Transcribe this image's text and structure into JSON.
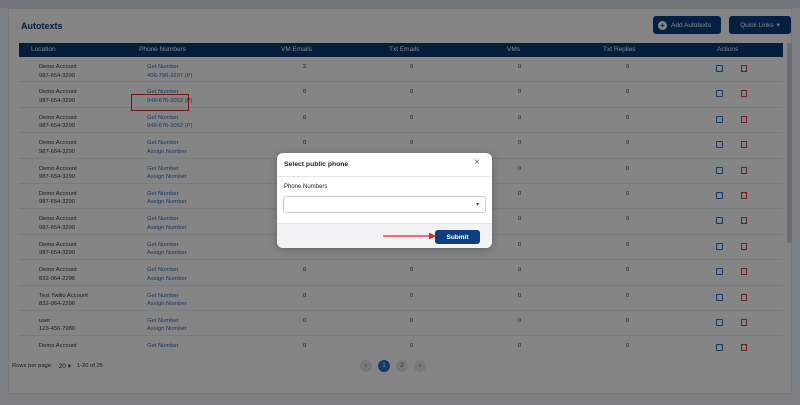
{
  "page": {
    "title": "Autotexts",
    "add_button": "Add Autotexts",
    "quick_links": "Quick Links"
  },
  "table": {
    "headers": [
      "Location",
      "Phone Numbers",
      "VM Emails",
      "Txt Emails",
      "VMs",
      "Txt Replies",
      "Actions"
    ],
    "rows": [
      {
        "location": "Demo Account",
        "phone": "987-654-3290",
        "link1": "Get Number",
        "link2": "406-798-3297 (P)",
        "vm_emails": "2",
        "txt_emails": "0",
        "vms": "0",
        "txt_replies": "0"
      },
      {
        "location": "Demo Account",
        "phone": "987-654-3290",
        "link1": "Get Number",
        "link2": "949-676-2052 (P)",
        "vm_emails": "0",
        "txt_emails": "0",
        "vms": "0",
        "txt_replies": "0"
      },
      {
        "location": "Demo Account",
        "phone": "987-654-3290",
        "link1": "Get Number",
        "link2": "949-676-2052 (P)",
        "vm_emails": "0",
        "txt_emails": "0",
        "vms": "0",
        "txt_replies": "0"
      },
      {
        "location": "Demo Account",
        "phone": "987-654-3290",
        "link1": "Get Number",
        "link2": "Assign Number",
        "vm_emails": "0",
        "txt_emails": "0",
        "vms": "0",
        "txt_replies": "0"
      },
      {
        "location": "Demo Account",
        "phone": "987-654-3290",
        "link1": "Get Number",
        "link2": "Assign Number",
        "vm_emails": "0",
        "txt_emails": "0",
        "vms": "0",
        "txt_replies": "0"
      },
      {
        "location": "Demo Account",
        "phone": "987-654-3290",
        "link1": "Get Number",
        "link2": "Assign Number",
        "vm_emails": "0",
        "txt_emails": "0",
        "vms": "0",
        "txt_replies": "0"
      },
      {
        "location": "Demo Account",
        "phone": "987-654-3290",
        "link1": "Get Number",
        "link2": "Assign Number",
        "vm_emails": "0",
        "txt_emails": "0",
        "vms": "0",
        "txt_replies": "0"
      },
      {
        "location": "Demo Account",
        "phone": "987-654-3290",
        "link1": "Get Number",
        "link2": "Assign Number",
        "vm_emails": "0",
        "txt_emails": "0",
        "vms": "0",
        "txt_replies": "0"
      },
      {
        "location": "Demo Account",
        "phone": "832-064-2296",
        "link1": "Get Number",
        "link2": "Assign Number",
        "vm_emails": "0",
        "txt_emails": "0",
        "vms": "0",
        "txt_replies": "0"
      },
      {
        "location": "Test Twilio Account",
        "phone": "832-064-2296",
        "link1": "Get Number",
        "link2": "Assign Number",
        "vm_emails": "0",
        "txt_emails": "0",
        "vms": "0",
        "txt_replies": "0"
      },
      {
        "location": "user",
        "phone": "123-456-7980",
        "link1": "Get Number",
        "link2": "Assign Number",
        "vm_emails": "0",
        "txt_emails": "0",
        "vms": "0",
        "txt_replies": "0"
      },
      {
        "location": "Demo Account",
        "phone": "",
        "link1": "Get Number",
        "link2": "",
        "vm_emails": "0",
        "txt_emails": "0",
        "vms": "0",
        "txt_replies": "0"
      }
    ]
  },
  "footer": {
    "rows_per_page_label": "Rows per page:",
    "rows_per_page_value": "20",
    "range": "1-20 of 25",
    "pages": [
      "1",
      "2"
    ],
    "prev": "‹",
    "next": "›"
  },
  "modal": {
    "title": "Select public phone",
    "close": "×",
    "field_label": "Phone Numbers",
    "select_value": "",
    "submit": "Submit"
  },
  "colors": {
    "primary": "#0c3f80",
    "link": "#2b6cc4",
    "highlight": "#e02626"
  }
}
